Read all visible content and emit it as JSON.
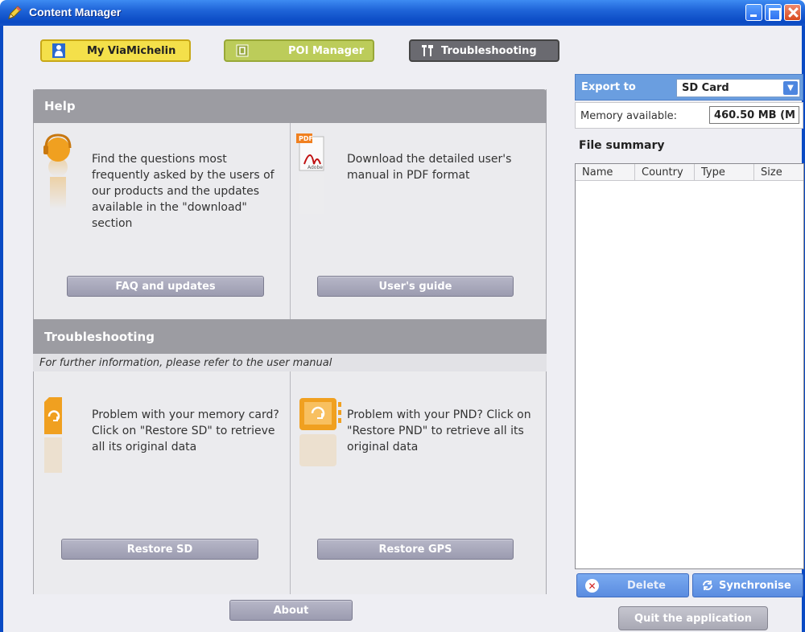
{
  "window": {
    "title": "Content Manager"
  },
  "tabs": [
    {
      "label": "My ViaMichelin",
      "icon": "person-icon"
    },
    {
      "label": "POI Manager",
      "icon": "poi-icon"
    },
    {
      "label": "Troubleshooting",
      "icon": "tools-icon"
    }
  ],
  "help": {
    "header": "Help",
    "faq": {
      "text": "Find the questions most frequently asked by the users of our products and the updates available in the \"download\" section",
      "button": "FAQ and updates",
      "icon": "headset-icon"
    },
    "guide": {
      "text": "Download the detailed user's manual in PDF format",
      "button": "User's guide",
      "icon": "pdf-icon"
    }
  },
  "troubleshooting": {
    "header": "Troubleshooting",
    "note": "For further information, please refer to the user manual",
    "sd": {
      "text": "Problem with your memory card? Click on \"Restore SD\" to retrieve all its original data",
      "button": "Restore SD",
      "icon": "sd-card-restore-icon"
    },
    "pnd": {
      "text": "Problem with your PND? Click on \"Restore PND\" to retrieve all its original data",
      "button": "Restore GPS",
      "icon": "gps-restore-icon"
    }
  },
  "about_button": "About",
  "export": {
    "label": "Export to",
    "selected": "SD Card",
    "memory_label": "Memory available:",
    "memory_value": "460.50 MB (M"
  },
  "file_summary": {
    "title": "File summary",
    "columns": [
      "Name",
      "Country",
      "Type",
      "Size"
    ],
    "rows": []
  },
  "delete_button": "Delete",
  "sync_button": "Synchronise",
  "quit_button": "Quit the application",
  "colors": {
    "titlebar": "#1f64d8",
    "tab_my": "#f4e04a",
    "tab_poi": "#bccc5a",
    "tab_trouble": "#6a6a70",
    "section_header": "#9c9ca2",
    "accent_orange": "#f0a020",
    "export_blue": "#6a9ee0"
  }
}
